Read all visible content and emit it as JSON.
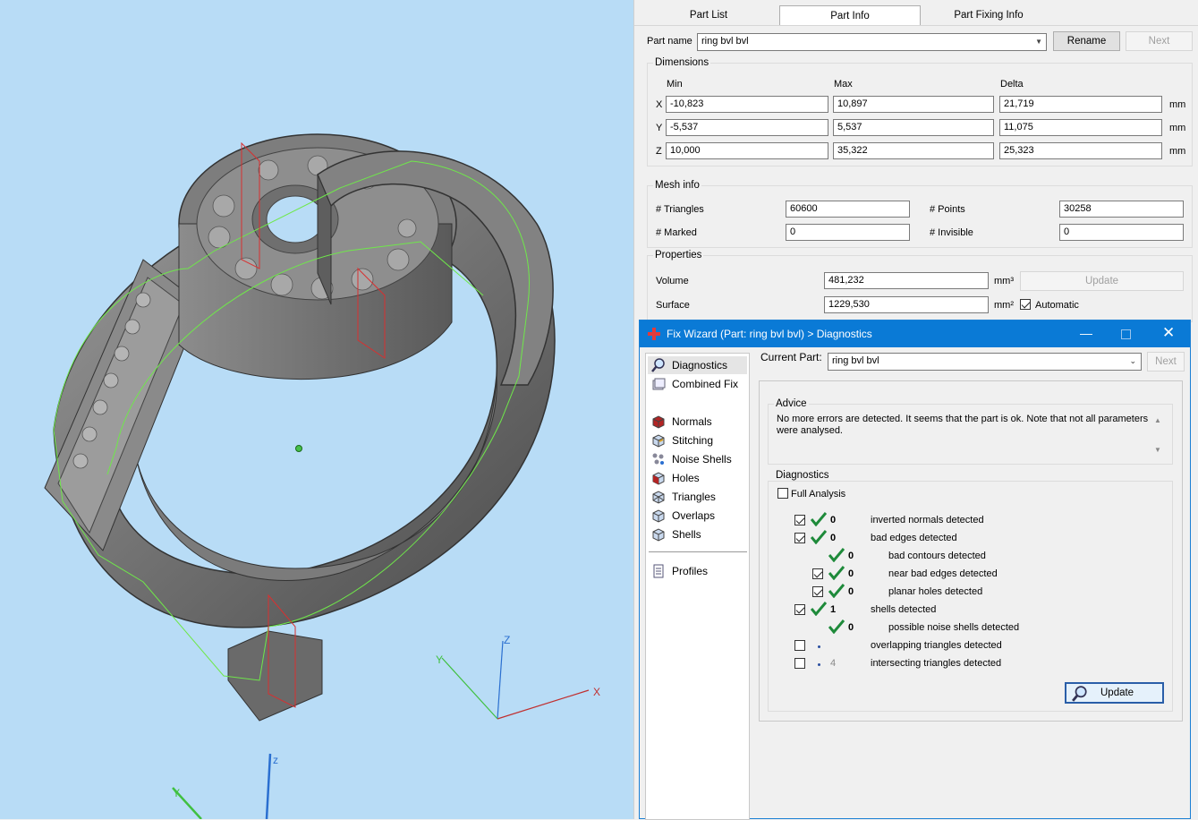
{
  "tabs": [
    {
      "label": "Part List"
    },
    {
      "label": "Part Info"
    },
    {
      "label": "Part Fixing Info"
    }
  ],
  "part": {
    "name_label": "Part name",
    "name_value": "ring bvl bvl",
    "rename": "Rename",
    "next": "Next"
  },
  "dimensions": {
    "title": "Dimensions",
    "headers": [
      "Min",
      "Max",
      "Delta"
    ],
    "rows": [
      {
        "axis": "X",
        "min": "-10,823",
        "max": "10,897",
        "delta": "21,719",
        "unit": "mm"
      },
      {
        "axis": "Y",
        "min": "-5,537",
        "max": "5,537",
        "delta": "11,075",
        "unit": "mm"
      },
      {
        "axis": "Z",
        "min": "10,000",
        "max": "35,322",
        "delta": "25,323",
        "unit": "mm"
      }
    ]
  },
  "mesh": {
    "title": "Mesh info",
    "triangles_label": "# Triangles",
    "triangles": "60600",
    "points_label": "# Points",
    "points": "30258",
    "marked_label": "# Marked",
    "marked": "0",
    "invisible_label": "# Invisible",
    "invisible": "0"
  },
  "properties": {
    "title": "Properties",
    "volume_label": "Volume",
    "volume": "481,232",
    "volume_unit": "mm³",
    "update": "Update",
    "surface_label": "Surface",
    "surface": "1229,530",
    "surface_unit": "mm²",
    "automatic": "Automatic"
  },
  "wizard": {
    "title": "Fix Wizard (Part: ring bvl bvl) > Diagnostics",
    "nav": [
      {
        "label": "Diagnostics",
        "icon": "magnifier-icon"
      },
      {
        "label": "Combined Fix",
        "icon": "combined-fix-icon"
      },
      {
        "label": "Normals",
        "icon": "normals-cube-icon"
      },
      {
        "label": "Stitching",
        "icon": "stitching-cube-icon"
      },
      {
        "label": "Noise Shells",
        "icon": "noise-shells-icon"
      },
      {
        "label": "Holes",
        "icon": "holes-cube-icon"
      },
      {
        "label": "Triangles",
        "icon": "triangles-cube-icon"
      },
      {
        "label": "Overlaps",
        "icon": "overlaps-cube-icon"
      },
      {
        "label": "Shells",
        "icon": "shells-cube-icon"
      },
      {
        "label": "Profiles",
        "icon": "profiles-icon"
      }
    ],
    "current_part_label": "Current Part:",
    "current_part": "ring bvl bvl",
    "next": "Next",
    "advice_title": "Advice",
    "advice_text": "No more errors are detected. It seems that the part is ok. Note that not all parameters were analysed.",
    "diag_title": "Diagnostics",
    "full_analysis": "Full Analysis",
    "items": [
      {
        "num": "0",
        "text": "inverted normals detected"
      },
      {
        "num": "0",
        "text": "bad edges detected"
      },
      {
        "num": "0",
        "text": "bad contours detected"
      },
      {
        "num": "0",
        "text": "near bad edges detected"
      },
      {
        "num": "0",
        "text": "planar holes detected"
      },
      {
        "num": "1",
        "text": "shells detected"
      },
      {
        "num": "0",
        "text": "possible noise shells detected"
      },
      {
        "num": "",
        "text": "overlapping triangles detected"
      },
      {
        "num": "4",
        "text": "intersecting triangles detected"
      }
    ],
    "update": "Update"
  },
  "axes": {
    "x": "X",
    "y": "Y",
    "z": "Z",
    "z2": "z",
    "y2": "Y"
  },
  "colors": {
    "viewport_bg": "#b8dcf6",
    "title_bar": "#0a7ad6",
    "check_green": "#1e8a3a",
    "model_gray": "#6b6b6b"
  }
}
